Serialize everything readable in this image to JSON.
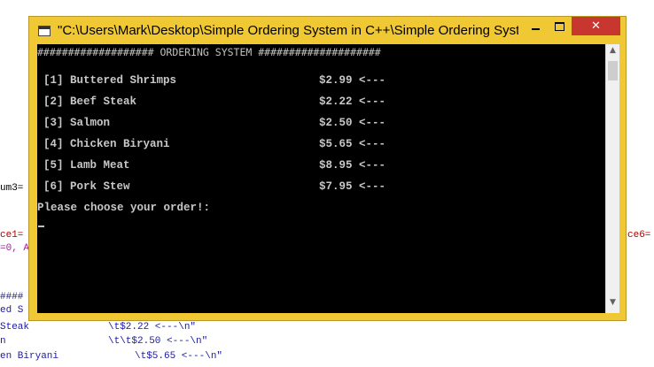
{
  "background_code": {
    "line_um3": "um3=",
    "line_ce1": "ce1=",
    "line_zero": "=0, A",
    "line_ce6": "ce6=",
    "line_hashes": "####",
    "line_ed": "ed S",
    "line_steak": "Steak",
    "line_steak_str": "\\t$2.22 <---\\n\"",
    "line_n": "n",
    "line_salmon_str": "\\t\\t$2.50 <---\\n\"",
    "line_biryani": "en Biryani",
    "line_biryani_str": "\\t$5.65 <---\\n\""
  },
  "window": {
    "title": "\"C:\\Users\\Mark\\Desktop\\Simple Ordering System in C++\\Simple Ordering Syst...",
    "close_glyph": "✕"
  },
  "console": {
    "header": "################### ORDERING SYSTEM ####################",
    "menu": [
      {
        "label": "[1] Buttered Shrimps",
        "price": "$2.99 <---"
      },
      {
        "label": "[2] Beef Steak",
        "price": "$2.22 <---"
      },
      {
        "label": "[3] Salmon",
        "price": "$2.50 <---"
      },
      {
        "label": "[4] Chicken Biryani",
        "price": "$5.65 <---"
      },
      {
        "label": "[5] Lamb Meat",
        "price": "$8.95 <---"
      },
      {
        "label": "[6] Pork Stew",
        "price": "$7.95 <---"
      }
    ],
    "prompt": "Please choose your order!:"
  },
  "scrollbar": {
    "up_glyph": "▲",
    "down_glyph": "▼"
  },
  "colors": {
    "titlebar": "#f0c833",
    "close_button": "#c7372f",
    "console_background": "#000000",
    "console_text": "#c0c0c0"
  }
}
